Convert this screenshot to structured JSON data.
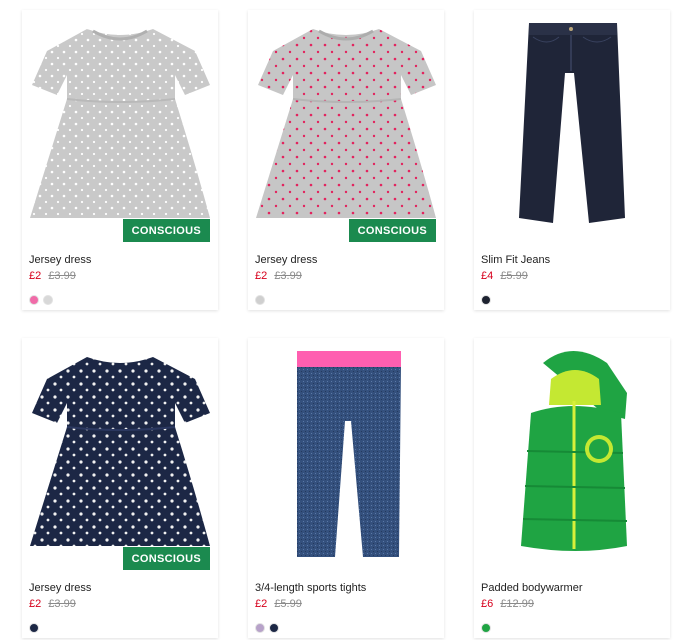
{
  "products": [
    {
      "name": "Jersey dress",
      "price_sale": "£2",
      "price_old": "£3.99",
      "badge": "CONSCIOUS",
      "image": "grey-dress-white-stars",
      "swatches": [
        "#f06ba8",
        "#d8d8d8"
      ]
    },
    {
      "name": "Jersey dress",
      "price_sale": "£2",
      "price_old": "£3.99",
      "badge": "CONSCIOUS",
      "image": "grey-dress-pink-hearts",
      "swatches": [
        "#cfcfcf"
      ]
    },
    {
      "name": "Slim Fit Jeans",
      "price_sale": "£4",
      "price_old": "£5.99",
      "badge": "",
      "image": "dark-blue-jeans",
      "swatches": [
        "#1d2230"
      ]
    },
    {
      "name": "Jersey dress",
      "price_sale": "£2",
      "price_old": "£3.99",
      "badge": "CONSCIOUS",
      "image": "navy-dress-white-stars",
      "swatches": [
        "#1c2745"
      ]
    },
    {
      "name": "3/4-length sports tights",
      "price_sale": "£2",
      "price_old": "£5.99",
      "badge": "",
      "image": "blue-tights-pink-waistband",
      "swatches": [
        "#b7a2c9",
        "#1c2745"
      ]
    },
    {
      "name": "Padded bodywarmer",
      "price_sale": "£6",
      "price_old": "£12.99",
      "badge": "",
      "image": "green-hooded-bodywarmer",
      "swatches": [
        "#1fa443"
      ]
    }
  ],
  "colors": {
    "sale_price": "#d6001c",
    "badge_bg": "#1b8a4f",
    "old_price": "#8a8a8a"
  }
}
